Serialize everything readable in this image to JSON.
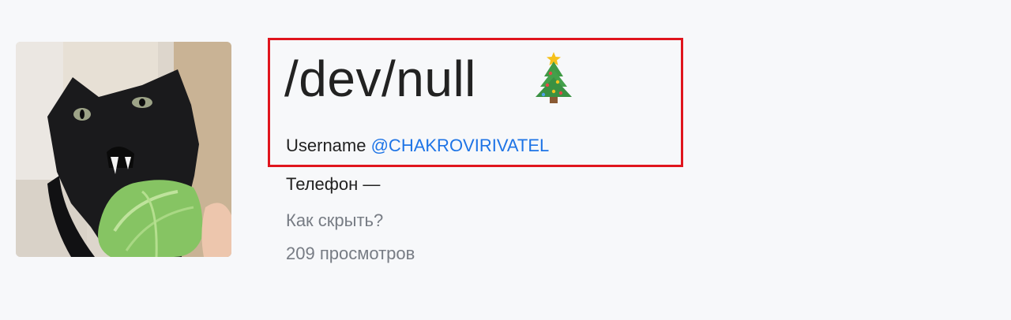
{
  "profile": {
    "display_name": "/dev/null",
    "name_emoji": "christmas-tree",
    "avatar_alt": "black-cat-with-lettuce",
    "username_label": "Username",
    "username_value": "@CHAKROVIRIVATEL",
    "phone_text": "Телефон —",
    "hide_link": "Как скрыть?",
    "views_text": "209 просмотров"
  },
  "colors": {
    "background": "#f7f8fa",
    "link": "#1e74e6",
    "muted": "#777c84",
    "highlight": "#e0151d"
  }
}
